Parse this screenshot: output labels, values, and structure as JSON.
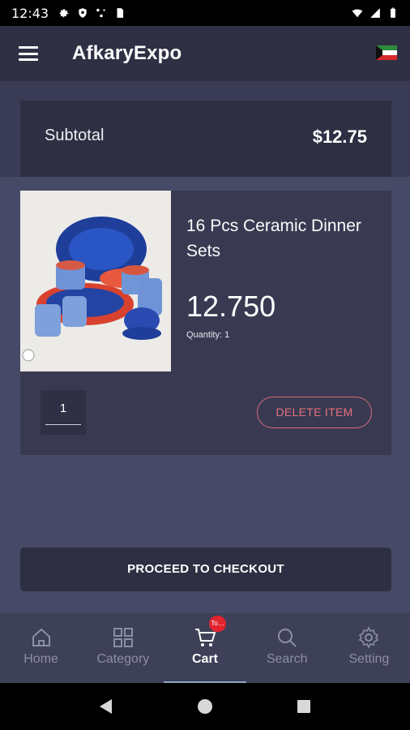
{
  "status_bar": {
    "time": "12:43",
    "left_icons": [
      "gear-icon",
      "shield-icon",
      "network-icon",
      "sim-icon"
    ],
    "right_icons": [
      "wifi-icon",
      "signal-icon",
      "battery-icon"
    ]
  },
  "app_bar": {
    "title": "AfkaryExpo",
    "menu_icon": "menu-icon",
    "flag_icon": "kuwait-flag-icon"
  },
  "subtotal": {
    "label": "Subtotal",
    "value": "$12.75"
  },
  "cart_item": {
    "name": "16 Pcs Ceramic Dinner Sets",
    "price": "12.750",
    "quantity_label": "Quantity: 1",
    "quantity_value": "1",
    "delete_label": "DELETE ITEM"
  },
  "checkout_label": "PROCEED TO CHECKOUT",
  "bottom_nav": {
    "items": [
      {
        "label": "Home",
        "icon": "home-icon"
      },
      {
        "label": "Category",
        "icon": "grid-icon"
      },
      {
        "label": "Cart",
        "icon": "cart-icon"
      },
      {
        "label": "Search",
        "icon": "search-icon"
      },
      {
        "label": "Setting",
        "icon": "settings-icon"
      }
    ],
    "active": "Cart",
    "cart_badge": "To…"
  },
  "colors": {
    "background": "#474a66",
    "app_bar": "#2f3043",
    "card": "#393a52",
    "accent_delete": "#e7707c",
    "badge": "#e1242d"
  }
}
